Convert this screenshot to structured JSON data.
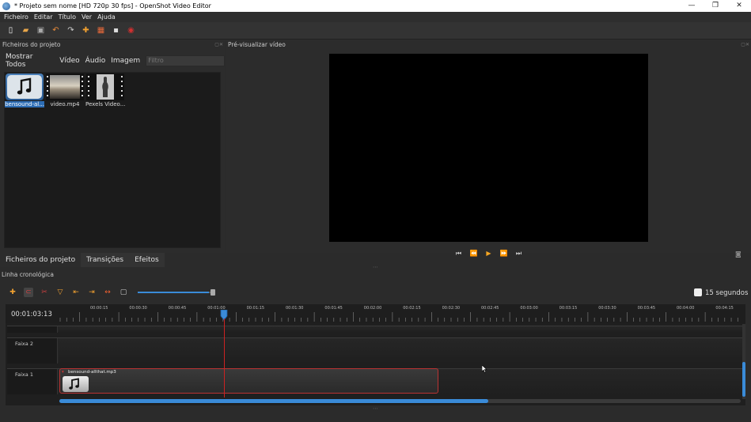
{
  "window": {
    "title": "* Projeto sem nome [HD 720p 30 fps] - OpenShot Video Editor",
    "minimize": "—",
    "maximize": "❐",
    "close": "✕"
  },
  "menu": {
    "items": [
      "Ficheiro",
      "Editar",
      "Título",
      "Ver",
      "Ajuda"
    ]
  },
  "project_files": {
    "header": "Ficheiros do projeto",
    "tabs": [
      "Mostrar Todos",
      "Vídeo",
      "Áudio",
      "Imagem"
    ],
    "filter_placeholder": "Filtro",
    "files": [
      {
        "name": "bensound-al...",
        "selected": true
      },
      {
        "name": "video.mp4",
        "selected": false
      },
      {
        "name": "Pexels Video...",
        "selected": false
      }
    ]
  },
  "preview": {
    "header": "Pré-visualizar vídeo",
    "background": "#000000"
  },
  "bottom_tabs": [
    "Ficheiros do projeto",
    "Transições",
    "Efeitos"
  ],
  "timeline": {
    "header": "Linha cronológica",
    "current_time": "00:01:03:13",
    "zoom_label": "15 segundos",
    "ruler_labels": [
      "00:00:15",
      "00:00:30",
      "00:00:45",
      "00:01:00",
      "00:01:15",
      "00:01:30",
      "00:01:45",
      "00:02:00",
      "00:02:15",
      "00:02:30",
      "00:02:45",
      "00:03:00",
      "00:03:15",
      "00:03:30",
      "00:03:45",
      "00:04:00",
      "00:04:15"
    ],
    "tracks": [
      {
        "name": "Faixa 2"
      },
      {
        "name": "Faixa 1"
      }
    ],
    "clip": {
      "title": "bensound-allthat.mp3",
      "border_color": "#bb3333"
    },
    "playhead_color": "#cc2222",
    "accent_color": "#3a8bd8"
  }
}
